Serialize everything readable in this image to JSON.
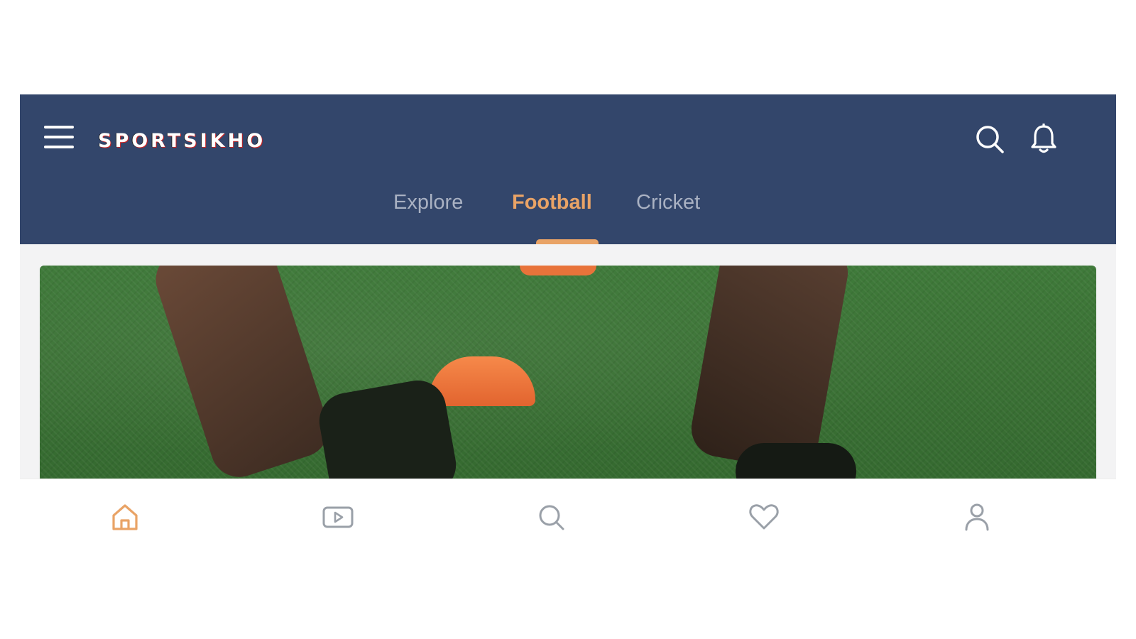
{
  "app": {
    "logo_text": "SPORTSIKHO"
  },
  "tabs": [
    {
      "label": "Explore",
      "active": false
    },
    {
      "label": "Football",
      "active": true
    },
    {
      "label": "Cricket",
      "active": false
    }
  ],
  "header_icons": [
    "menu-icon",
    "search-icon",
    "bell-icon"
  ],
  "bottom_nav": [
    {
      "icon": "home-icon",
      "active": true
    },
    {
      "icon": "video-icon",
      "active": false
    },
    {
      "icon": "search-icon",
      "active": false
    },
    {
      "icon": "heart-icon",
      "active": false
    },
    {
      "icon": "user-icon",
      "active": false
    }
  ],
  "colors": {
    "header_bg": "#33466b",
    "accent": "#e9a366",
    "inactive_tab": "#a9b1c2",
    "inactive_icon": "#9aa0a8"
  }
}
